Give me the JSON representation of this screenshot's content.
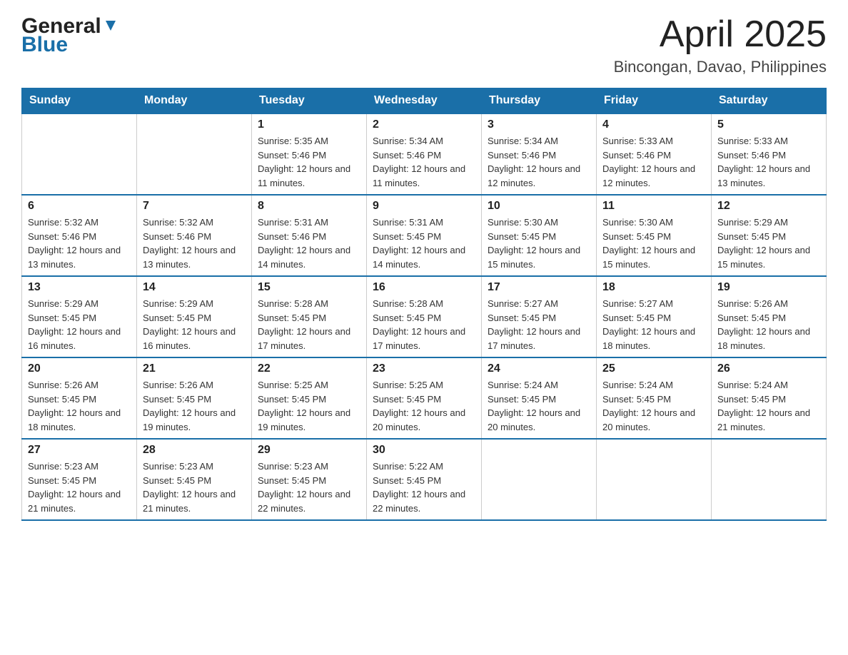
{
  "header": {
    "logo_general": "General",
    "logo_blue": "Blue",
    "title": "April 2025",
    "location": "Bincongan, Davao, Philippines"
  },
  "days_of_week": [
    "Sunday",
    "Monday",
    "Tuesday",
    "Wednesday",
    "Thursday",
    "Friday",
    "Saturday"
  ],
  "weeks": [
    [
      {
        "day": "",
        "sunrise": "",
        "sunset": "",
        "daylight": ""
      },
      {
        "day": "",
        "sunrise": "",
        "sunset": "",
        "daylight": ""
      },
      {
        "day": "1",
        "sunrise": "Sunrise: 5:35 AM",
        "sunset": "Sunset: 5:46 PM",
        "daylight": "Daylight: 12 hours and 11 minutes."
      },
      {
        "day": "2",
        "sunrise": "Sunrise: 5:34 AM",
        "sunset": "Sunset: 5:46 PM",
        "daylight": "Daylight: 12 hours and 11 minutes."
      },
      {
        "day": "3",
        "sunrise": "Sunrise: 5:34 AM",
        "sunset": "Sunset: 5:46 PM",
        "daylight": "Daylight: 12 hours and 12 minutes."
      },
      {
        "day": "4",
        "sunrise": "Sunrise: 5:33 AM",
        "sunset": "Sunset: 5:46 PM",
        "daylight": "Daylight: 12 hours and 12 minutes."
      },
      {
        "day": "5",
        "sunrise": "Sunrise: 5:33 AM",
        "sunset": "Sunset: 5:46 PM",
        "daylight": "Daylight: 12 hours and 13 minutes."
      }
    ],
    [
      {
        "day": "6",
        "sunrise": "Sunrise: 5:32 AM",
        "sunset": "Sunset: 5:46 PM",
        "daylight": "Daylight: 12 hours and 13 minutes."
      },
      {
        "day": "7",
        "sunrise": "Sunrise: 5:32 AM",
        "sunset": "Sunset: 5:46 PM",
        "daylight": "Daylight: 12 hours and 13 minutes."
      },
      {
        "day": "8",
        "sunrise": "Sunrise: 5:31 AM",
        "sunset": "Sunset: 5:46 PM",
        "daylight": "Daylight: 12 hours and 14 minutes."
      },
      {
        "day": "9",
        "sunrise": "Sunrise: 5:31 AM",
        "sunset": "Sunset: 5:45 PM",
        "daylight": "Daylight: 12 hours and 14 minutes."
      },
      {
        "day": "10",
        "sunrise": "Sunrise: 5:30 AM",
        "sunset": "Sunset: 5:45 PM",
        "daylight": "Daylight: 12 hours and 15 minutes."
      },
      {
        "day": "11",
        "sunrise": "Sunrise: 5:30 AM",
        "sunset": "Sunset: 5:45 PM",
        "daylight": "Daylight: 12 hours and 15 minutes."
      },
      {
        "day": "12",
        "sunrise": "Sunrise: 5:29 AM",
        "sunset": "Sunset: 5:45 PM",
        "daylight": "Daylight: 12 hours and 15 minutes."
      }
    ],
    [
      {
        "day": "13",
        "sunrise": "Sunrise: 5:29 AM",
        "sunset": "Sunset: 5:45 PM",
        "daylight": "Daylight: 12 hours and 16 minutes."
      },
      {
        "day": "14",
        "sunrise": "Sunrise: 5:29 AM",
        "sunset": "Sunset: 5:45 PM",
        "daylight": "Daylight: 12 hours and 16 minutes."
      },
      {
        "day": "15",
        "sunrise": "Sunrise: 5:28 AM",
        "sunset": "Sunset: 5:45 PM",
        "daylight": "Daylight: 12 hours and 17 minutes."
      },
      {
        "day": "16",
        "sunrise": "Sunrise: 5:28 AM",
        "sunset": "Sunset: 5:45 PM",
        "daylight": "Daylight: 12 hours and 17 minutes."
      },
      {
        "day": "17",
        "sunrise": "Sunrise: 5:27 AM",
        "sunset": "Sunset: 5:45 PM",
        "daylight": "Daylight: 12 hours and 17 minutes."
      },
      {
        "day": "18",
        "sunrise": "Sunrise: 5:27 AM",
        "sunset": "Sunset: 5:45 PM",
        "daylight": "Daylight: 12 hours and 18 minutes."
      },
      {
        "day": "19",
        "sunrise": "Sunrise: 5:26 AM",
        "sunset": "Sunset: 5:45 PM",
        "daylight": "Daylight: 12 hours and 18 minutes."
      }
    ],
    [
      {
        "day": "20",
        "sunrise": "Sunrise: 5:26 AM",
        "sunset": "Sunset: 5:45 PM",
        "daylight": "Daylight: 12 hours and 18 minutes."
      },
      {
        "day": "21",
        "sunrise": "Sunrise: 5:26 AM",
        "sunset": "Sunset: 5:45 PM",
        "daylight": "Daylight: 12 hours and 19 minutes."
      },
      {
        "day": "22",
        "sunrise": "Sunrise: 5:25 AM",
        "sunset": "Sunset: 5:45 PM",
        "daylight": "Daylight: 12 hours and 19 minutes."
      },
      {
        "day": "23",
        "sunrise": "Sunrise: 5:25 AM",
        "sunset": "Sunset: 5:45 PM",
        "daylight": "Daylight: 12 hours and 20 minutes."
      },
      {
        "day": "24",
        "sunrise": "Sunrise: 5:24 AM",
        "sunset": "Sunset: 5:45 PM",
        "daylight": "Daylight: 12 hours and 20 minutes."
      },
      {
        "day": "25",
        "sunrise": "Sunrise: 5:24 AM",
        "sunset": "Sunset: 5:45 PM",
        "daylight": "Daylight: 12 hours and 20 minutes."
      },
      {
        "day": "26",
        "sunrise": "Sunrise: 5:24 AM",
        "sunset": "Sunset: 5:45 PM",
        "daylight": "Daylight: 12 hours and 21 minutes."
      }
    ],
    [
      {
        "day": "27",
        "sunrise": "Sunrise: 5:23 AM",
        "sunset": "Sunset: 5:45 PM",
        "daylight": "Daylight: 12 hours and 21 minutes."
      },
      {
        "day": "28",
        "sunrise": "Sunrise: 5:23 AM",
        "sunset": "Sunset: 5:45 PM",
        "daylight": "Daylight: 12 hours and 21 minutes."
      },
      {
        "day": "29",
        "sunrise": "Sunrise: 5:23 AM",
        "sunset": "Sunset: 5:45 PM",
        "daylight": "Daylight: 12 hours and 22 minutes."
      },
      {
        "day": "30",
        "sunrise": "Sunrise: 5:22 AM",
        "sunset": "Sunset: 5:45 PM",
        "daylight": "Daylight: 12 hours and 22 minutes."
      },
      {
        "day": "",
        "sunrise": "",
        "sunset": "",
        "daylight": ""
      },
      {
        "day": "",
        "sunrise": "",
        "sunset": "",
        "daylight": ""
      },
      {
        "day": "",
        "sunrise": "",
        "sunset": "",
        "daylight": ""
      }
    ]
  ]
}
